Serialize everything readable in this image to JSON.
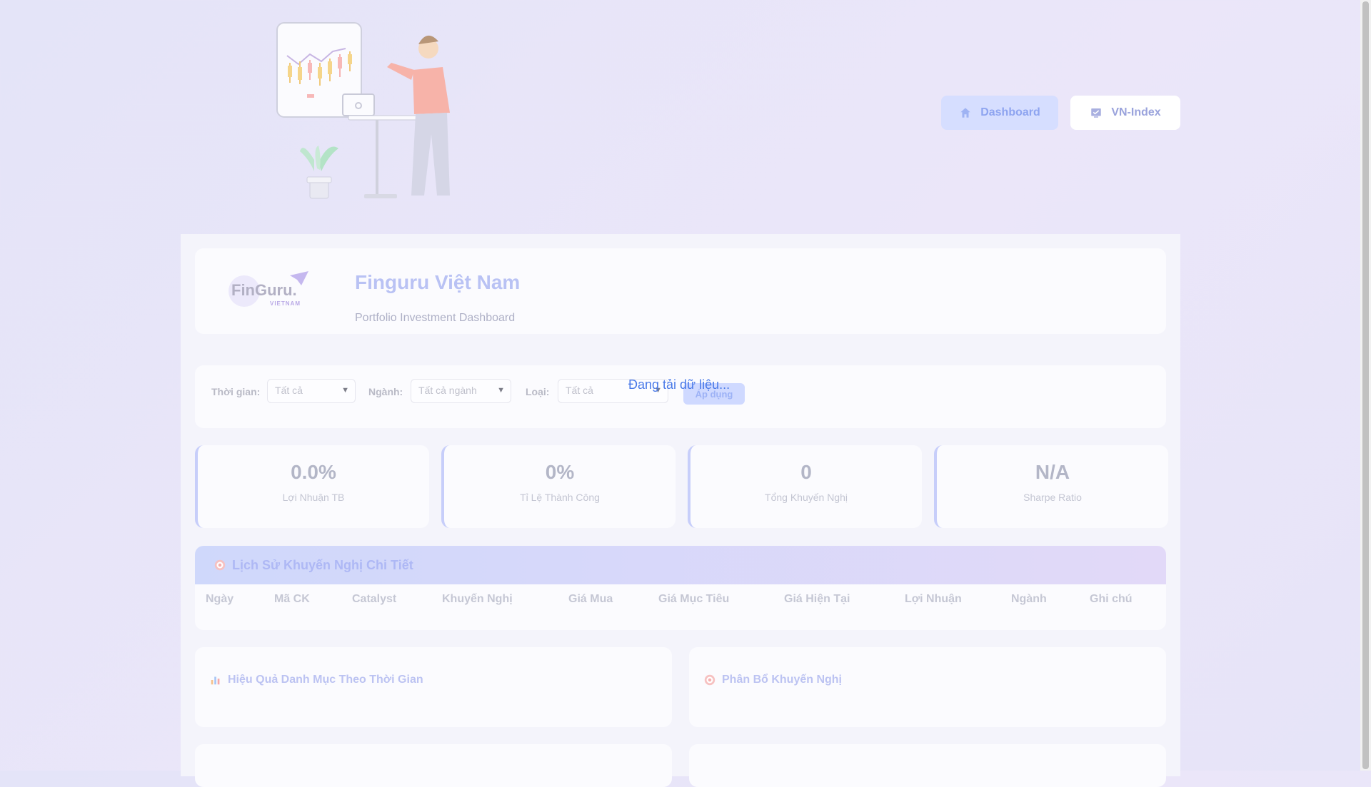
{
  "nav": {
    "dashboard_label": "Dashboard",
    "vnindex_label": "VN-Index"
  },
  "brand": {
    "logo_text": "FinGuru.",
    "logo_subtext": "VIETNAM",
    "title": "Finguru Việt Nam",
    "subtitle": "Portfolio Investment Dashboard"
  },
  "filters": {
    "time_label": "Thời gian:",
    "time_value": "Tất cả",
    "sector_label": "Ngành:",
    "sector_value": "Tất cả ngành",
    "type_label": "Loại:",
    "type_value": "Tất cả",
    "apply_label": "Áp dụng"
  },
  "loading_text": "Đang tải dữ liệu...",
  "stats": [
    {
      "value": "0.0%",
      "label": "Lợi Nhuận TB"
    },
    {
      "value": "0%",
      "label": "Tỉ Lệ Thành Công"
    },
    {
      "value": "0",
      "label": "Tổng Khuyến Nghị"
    },
    {
      "value": "N/A",
      "label": "Sharpe Ratio"
    }
  ],
  "history_table": {
    "title": "Lịch Sử Khuyến Nghị Chi Tiết",
    "columns": [
      "Ngày",
      "Mã CK",
      "Catalyst",
      "Khuyến Nghị",
      "Giá Mua",
      "Giá Mục Tiêu",
      "Giá Hiện Tại",
      "Lợi Nhuận",
      "Ngành",
      "Ghi chú"
    ]
  },
  "charts": {
    "performance_title": "Hiệu Quả Danh Mục Theo Thời Gian",
    "distribution_title": "Phân Bổ Khuyến Nghị"
  },
  "colors": {
    "accent": "#4a7ae8",
    "background": "#e6e4f8"
  },
  "icons": {
    "dashboard": "home-icon",
    "vnindex": "chart-check-icon",
    "history": "target-icon",
    "performance": "bar-chart-icon",
    "distribution": "target-icon"
  }
}
